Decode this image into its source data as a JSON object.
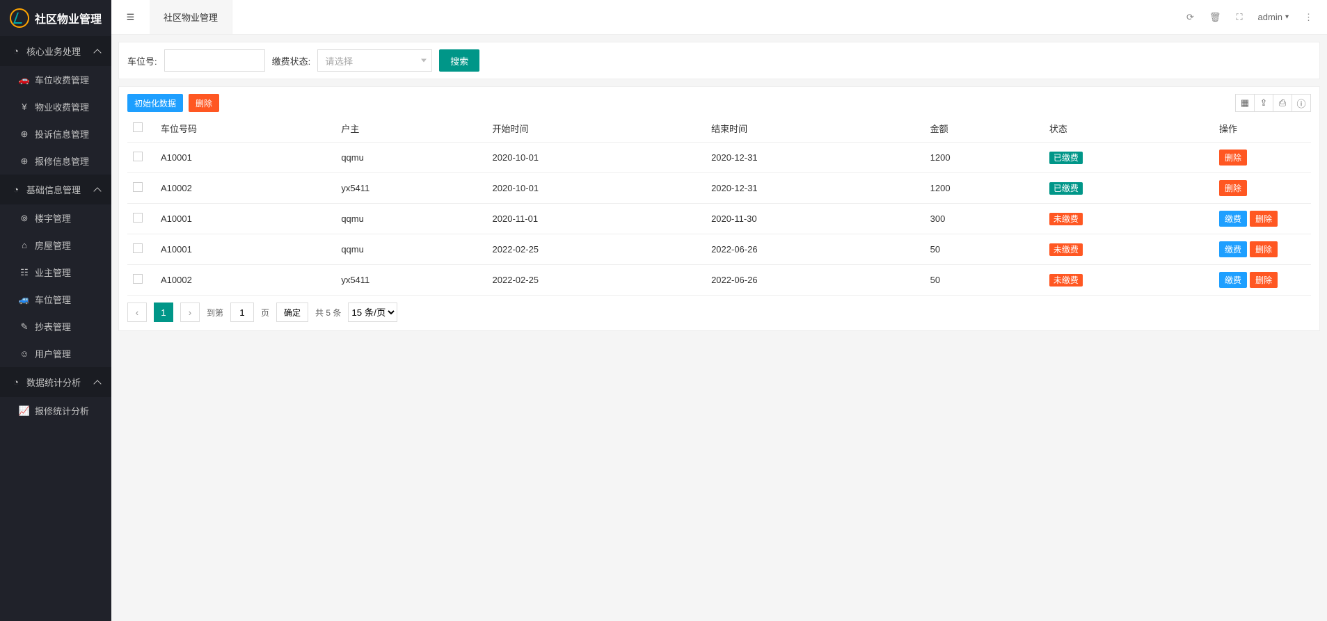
{
  "app": {
    "title": "社区物业管理"
  },
  "sidebar": {
    "groups": [
      {
        "label": "核心业务处理",
        "items": [
          {
            "label": "车位收费管理",
            "icon": "dashboard-icon"
          },
          {
            "label": "物业收费管理",
            "icon": "yen-icon"
          },
          {
            "label": "投诉信息管理",
            "icon": "circle-plus-icon"
          },
          {
            "label": "报修信息管理",
            "icon": "circle-plus-icon"
          }
        ]
      },
      {
        "label": "基础信息管理",
        "items": [
          {
            "label": "楼宇管理",
            "icon": "building-icon"
          },
          {
            "label": "房屋管理",
            "icon": "home-icon"
          },
          {
            "label": "业主管理",
            "icon": "users-icon"
          },
          {
            "label": "车位管理",
            "icon": "car-icon"
          },
          {
            "label": "抄表管理",
            "icon": "edit-icon"
          },
          {
            "label": "用户管理",
            "icon": "user-icon"
          }
        ]
      },
      {
        "label": "数据统计分析",
        "items": [
          {
            "label": "报修统计分析",
            "icon": "chart-icon"
          }
        ]
      }
    ]
  },
  "topbar": {
    "tab_label": "社区物业管理",
    "user": "admin"
  },
  "search": {
    "space_label": "车位号:",
    "status_label": "缴费状态:",
    "select_placeholder": "请选择",
    "search_btn": "搜索"
  },
  "toolbar": {
    "init_btn": "初始化数据",
    "delete_btn": "删除"
  },
  "table": {
    "columns": [
      "车位号码",
      "户主",
      "开始时间",
      "结束时间",
      "金额",
      "状态",
      "操作"
    ],
    "status_paid": "已缴费",
    "status_unpaid": "未缴费",
    "op_pay": "缴费",
    "op_delete": "删除",
    "rows": [
      {
        "code": "A10001",
        "owner": "qqmu",
        "start": "2020-10-01",
        "end": "2020-12-31",
        "amount": "1200",
        "paid": true
      },
      {
        "code": "A10002",
        "owner": "yx5411",
        "start": "2020-10-01",
        "end": "2020-12-31",
        "amount": "1200",
        "paid": true
      },
      {
        "code": "A10001",
        "owner": "qqmu",
        "start": "2020-11-01",
        "end": "2020-11-30",
        "amount": "300",
        "paid": false
      },
      {
        "code": "A10001",
        "owner": "qqmu",
        "start": "2022-02-25",
        "end": "2022-06-26",
        "amount": "50",
        "paid": false
      },
      {
        "code": "A10002",
        "owner": "yx5411",
        "start": "2022-02-25",
        "end": "2022-06-26",
        "amount": "50",
        "paid": false
      }
    ]
  },
  "pager": {
    "current": "1",
    "goto_prefix": "到第",
    "goto_value": "1",
    "goto_suffix": "页",
    "confirm": "确定",
    "total": "共 5 条",
    "per_page": "15 条/页"
  }
}
